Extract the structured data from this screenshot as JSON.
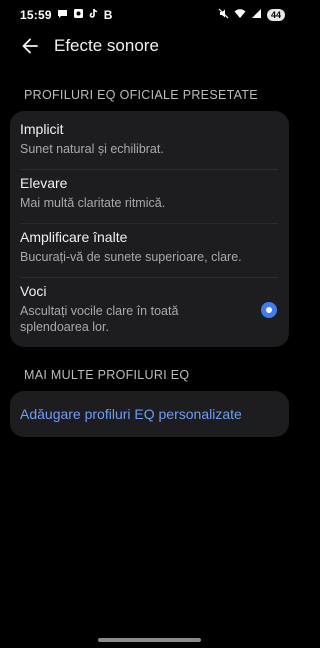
{
  "status_bar": {
    "time": "15:59",
    "left_icons": [
      "chat-bubble-icon",
      "gallery-icon",
      "tiktok-icon"
    ],
    "b_label": "B",
    "right_icons": [
      "mute-icon",
      "wifi-icon",
      "signal-icon"
    ],
    "battery": "44"
  },
  "header": {
    "back_icon": "arrow-left-icon",
    "title": "Efecte sonore"
  },
  "sections": {
    "official": {
      "label": "PROFILURI EQ OFICIALE PRESETATE",
      "items": [
        {
          "title": "Implicit",
          "subtitle": "Sunet natural și echilibrat.",
          "selected": false
        },
        {
          "title": "Elevare",
          "subtitle": "Mai multă claritate ritmică.",
          "selected": false
        },
        {
          "title": "Amplificare înalte",
          "subtitle": "Bucurați-vă de sunete superioare, clare.",
          "selected": false
        },
        {
          "title": "Voci",
          "subtitle": "Ascultați vocile clare în toată splendoarea lor.",
          "selected": true
        }
      ]
    },
    "more": {
      "label": "MAI MULTE PROFILURI EQ",
      "add_link": "Adăugare profiluri EQ personalizate"
    }
  },
  "colors": {
    "background": "#000000",
    "card": "#1d1d1f",
    "accent": "#3e7cf6",
    "link": "#6f9cf6"
  }
}
